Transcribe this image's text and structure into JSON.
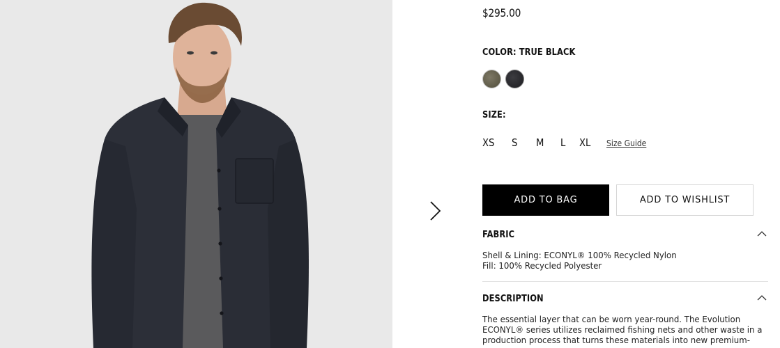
{
  "product": {
    "price": "$295.00",
    "color_label": "COLOR: TRUE BLACK",
    "swatches": [
      {
        "name": "olive",
        "color": "#6b6752"
      },
      {
        "name": "true black",
        "color": "#2a2a2e"
      }
    ],
    "size_label": "SIZE:",
    "sizes": [
      "XS",
      "S",
      "M",
      "L",
      "XL"
    ],
    "size_guide": "Size Guide"
  },
  "actions": {
    "add_to_bag": "ADD TO BAG",
    "add_to_wishlist": "ADD TO WISHLIST"
  },
  "fabric": {
    "title": "FABRIC",
    "lines": [
      "Shell & Lining: ECONYL® 100% Recycled Nylon",
      "Fill: 100% Recycled Polyester"
    ]
  },
  "description": {
    "title": "DESCRIPTION",
    "text": "The essential layer that can be worn year-round. The Evolution ECONYL® series utilizes reclaimed fishing nets and other waste in a production process that turns these materials into new premium-"
  },
  "icons": {
    "next": "chevron-right-icon",
    "collapse": "chevron-up-icon"
  }
}
